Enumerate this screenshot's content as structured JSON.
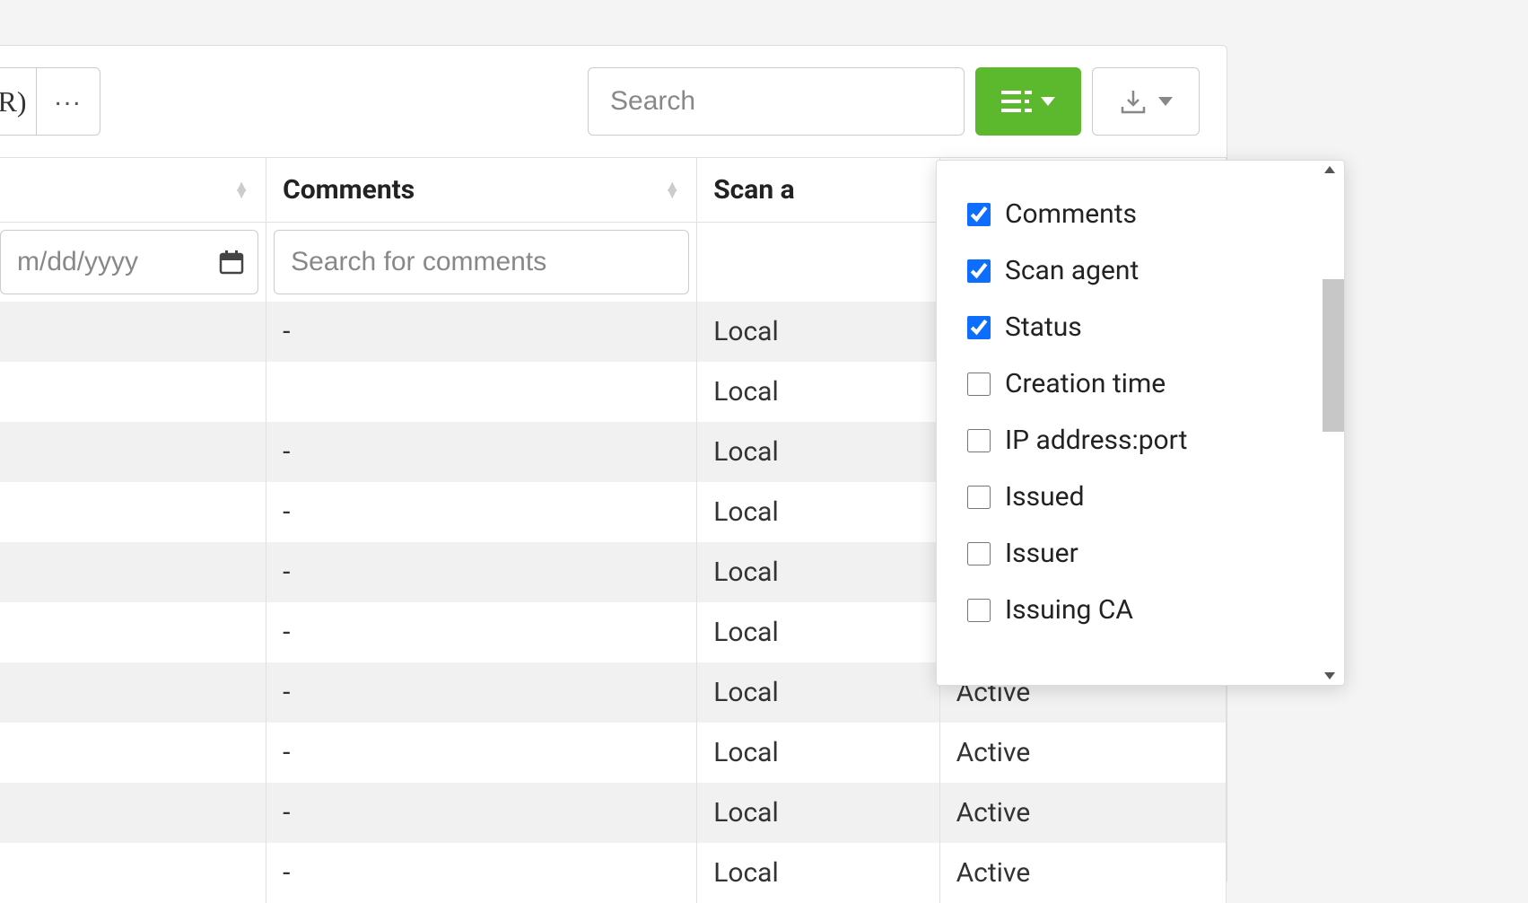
{
  "toolbar": {
    "r_button_label": "R)",
    "dots_label": "...",
    "search_placeholder": "Search"
  },
  "columns": {
    "date": {
      "header": "",
      "placeholder": "m/dd/yyyy"
    },
    "comments": {
      "header": "Comments",
      "placeholder": "Search for comments"
    },
    "agent": {
      "header": "Scan a"
    },
    "status": {
      "header": ""
    }
  },
  "rows": [
    {
      "date": "",
      "comments": "-",
      "agent": "Local",
      "status": ""
    },
    {
      "date": "",
      "comments": "",
      "agent": "Local",
      "status": ""
    },
    {
      "date": "",
      "comments": "-",
      "agent": "Local",
      "status": ""
    },
    {
      "date": "",
      "comments": "-",
      "agent": "Local",
      "status": ""
    },
    {
      "date": "",
      "comments": "-",
      "agent": "Local",
      "status": ""
    },
    {
      "date": "",
      "comments": "-",
      "agent": "Local",
      "status": ""
    },
    {
      "date": "",
      "comments": "-",
      "agent": "Local",
      "status": "Active"
    },
    {
      "date": "",
      "comments": "-",
      "agent": "Local",
      "status": "Active"
    },
    {
      "date": "",
      "comments": "-",
      "agent": "Local",
      "status": "Active"
    },
    {
      "date": "",
      "comments": "-",
      "agent": "Local",
      "status": "Active"
    }
  ],
  "column_picker": {
    "items": [
      {
        "label": "Comments",
        "checked": true
      },
      {
        "label": "Scan agent",
        "checked": true
      },
      {
        "label": "Status",
        "checked": true
      },
      {
        "label": "Creation time",
        "checked": false
      },
      {
        "label": "IP address:port",
        "checked": false
      },
      {
        "label": "Issued",
        "checked": false
      },
      {
        "label": "Issuer",
        "checked": false
      },
      {
        "label": "Issuing CA",
        "checked": false
      }
    ]
  }
}
